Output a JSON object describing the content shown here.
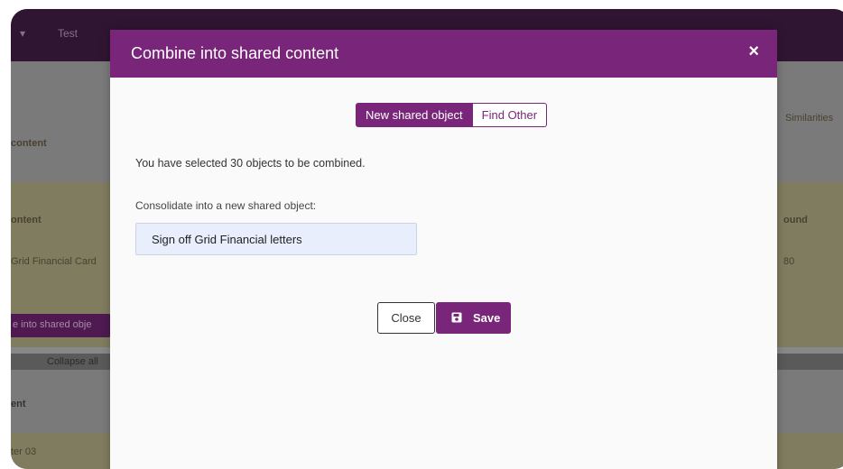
{
  "background": {
    "tabs": [
      "Test",
      "Test"
    ],
    "texts": [
      "content",
      "ontent",
      "Grid Financial Card",
      "Similarities",
      "ound",
      "80",
      "e into shared obje",
      "Collapse all",
      "ent",
      "ter 03"
    ]
  },
  "modal": {
    "title": "Combine into shared content",
    "close_glyph": "×",
    "segment": {
      "new_label": "New shared object",
      "find_label": "Find Other"
    },
    "selection_text": "You have selected 30 objects to be combined.",
    "consolidate_label": "Consolidate into a new shared object:",
    "name_value": "Sign off Grid Financial letters",
    "close_label": "Close",
    "save_label": "Save"
  },
  "colors": {
    "accent": "#78257a",
    "field_bg": "#e8eefc"
  }
}
